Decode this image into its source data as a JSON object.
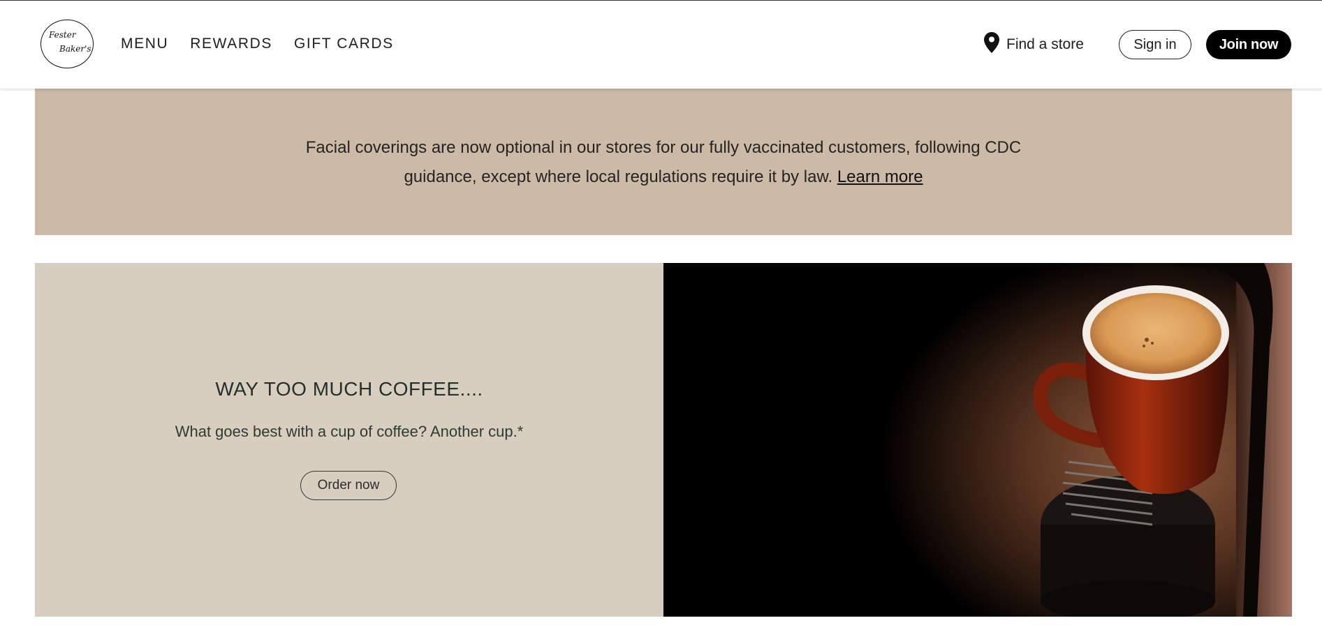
{
  "header": {
    "logo": {
      "line1": "Fester",
      "line2": "Baker's"
    },
    "nav": [
      "MENU",
      "REWARDS",
      "GIFT CARDS"
    ],
    "find_store": {
      "icon": "location-pin-icon",
      "label": "Find a store"
    },
    "sign_in": "Sign in",
    "join_now": "Join now"
  },
  "notice": {
    "text_line1": "Facial coverings are now optional in our stores for our fully vaccinated customers, following CDC",
    "text_line2": "guidance, except where local regulations require it by law.",
    "link": "Learn more"
  },
  "promo": {
    "title": "WAY TOO MUCH COFFEE....",
    "subtitle": "What goes best with a cup of coffee? Another cup.*",
    "cta": "Order now",
    "image": "coffee-cup-on-espresso-machine"
  },
  "colors": {
    "notice_bg": "#ccb9a6",
    "promo_bg": "#d8cebf",
    "join_bg": "#000000"
  }
}
